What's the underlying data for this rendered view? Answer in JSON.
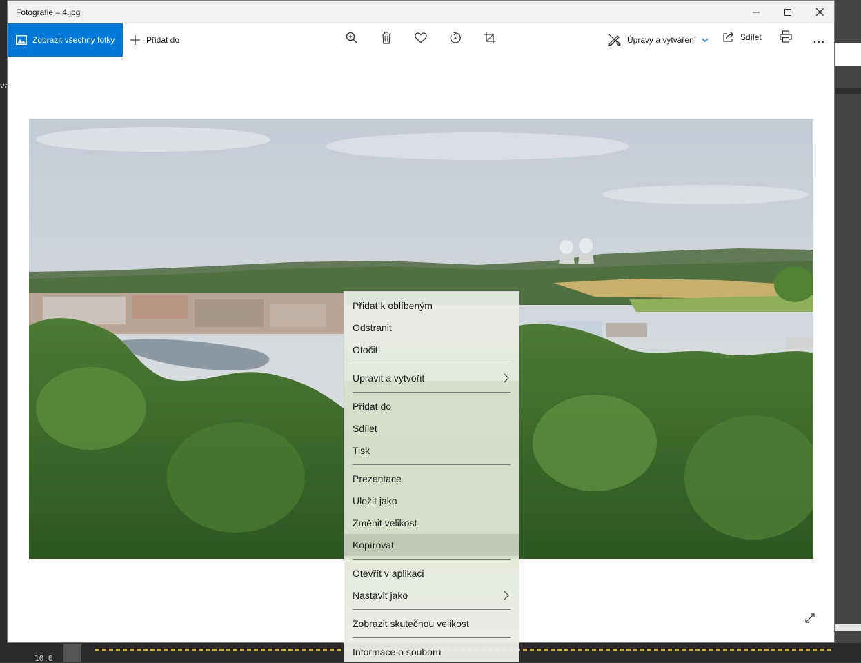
{
  "window": {
    "title": "Fotografie – 4.jpg"
  },
  "toolbar": {
    "view_all_label": "Zobrazit všechny fotky",
    "add_to_label": "Přidat do",
    "edit_create_label": "Úpravy a vytváření",
    "share_label": "Sdílet",
    "tools": [
      "zoom-in-icon",
      "delete-icon",
      "favorite-icon",
      "rotate-icon",
      "crop-icon"
    ]
  },
  "context_menu": {
    "items": [
      {
        "label": "Přidat k oblíbeným"
      },
      {
        "label": "Odstranit"
      },
      {
        "label": "Otočit"
      },
      {
        "label": "Upravit a vytvořit",
        "submenu": true
      },
      {
        "label": "Přidat do"
      },
      {
        "label": "Sdílet"
      },
      {
        "label": "Tisk"
      },
      {
        "label": "Prezentace"
      },
      {
        "label": "Uložit jako"
      },
      {
        "label": "Změnit velikost"
      },
      {
        "label": "Kopírovat",
        "highlighted": true
      },
      {
        "label": "Otevřít v aplikaci"
      },
      {
        "label": "Nastavit jako",
        "submenu": true
      },
      {
        "label": "Zobrazit skutečnou velikost"
      },
      {
        "label": "Informace o souboru"
      }
    ]
  },
  "background": {
    "bottom_number": "10.0"
  },
  "colors": {
    "accent": "#0078d7",
    "titlebar": "#f2f2f2",
    "menu_highlight": "#c8cbc3"
  }
}
